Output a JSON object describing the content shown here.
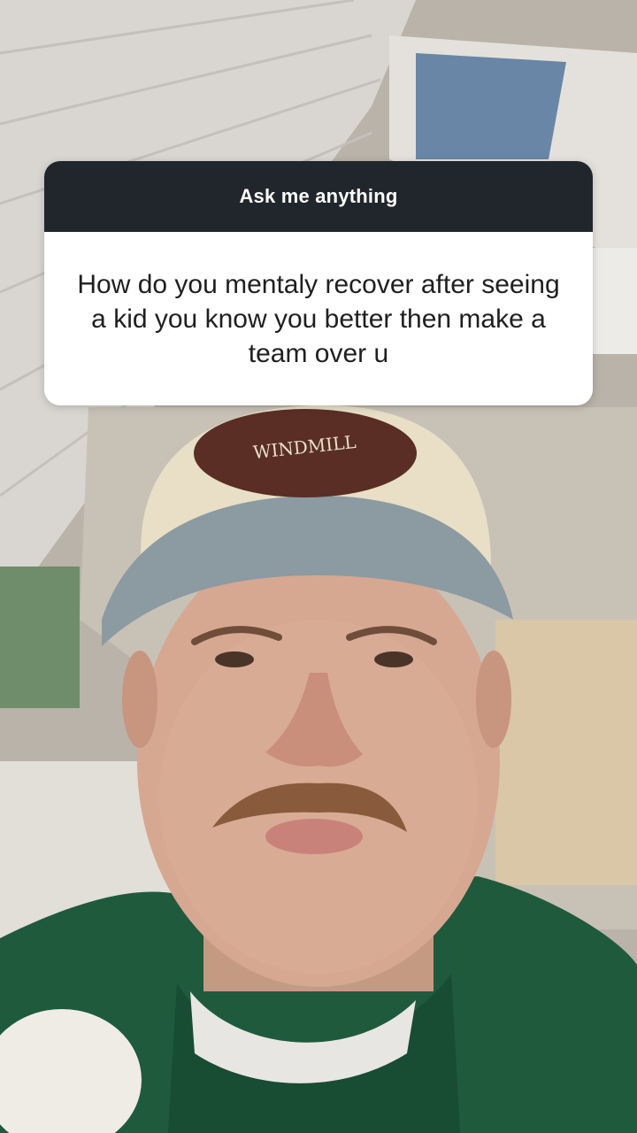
{
  "question_sticker": {
    "header": "Ask me anything",
    "question": "How do you mentaly recover after seeing a kid you know you better then make a team over u"
  },
  "hat_patch_text": "WINDMILL",
  "colors": {
    "header_bg": "#21252c",
    "card_bg": "#ffffff",
    "hoodie": "#1f5a3d",
    "hat_front": "#e8dfc6",
    "hat_brim": "#8c9aa2",
    "patch": "#5a2e25"
  }
}
